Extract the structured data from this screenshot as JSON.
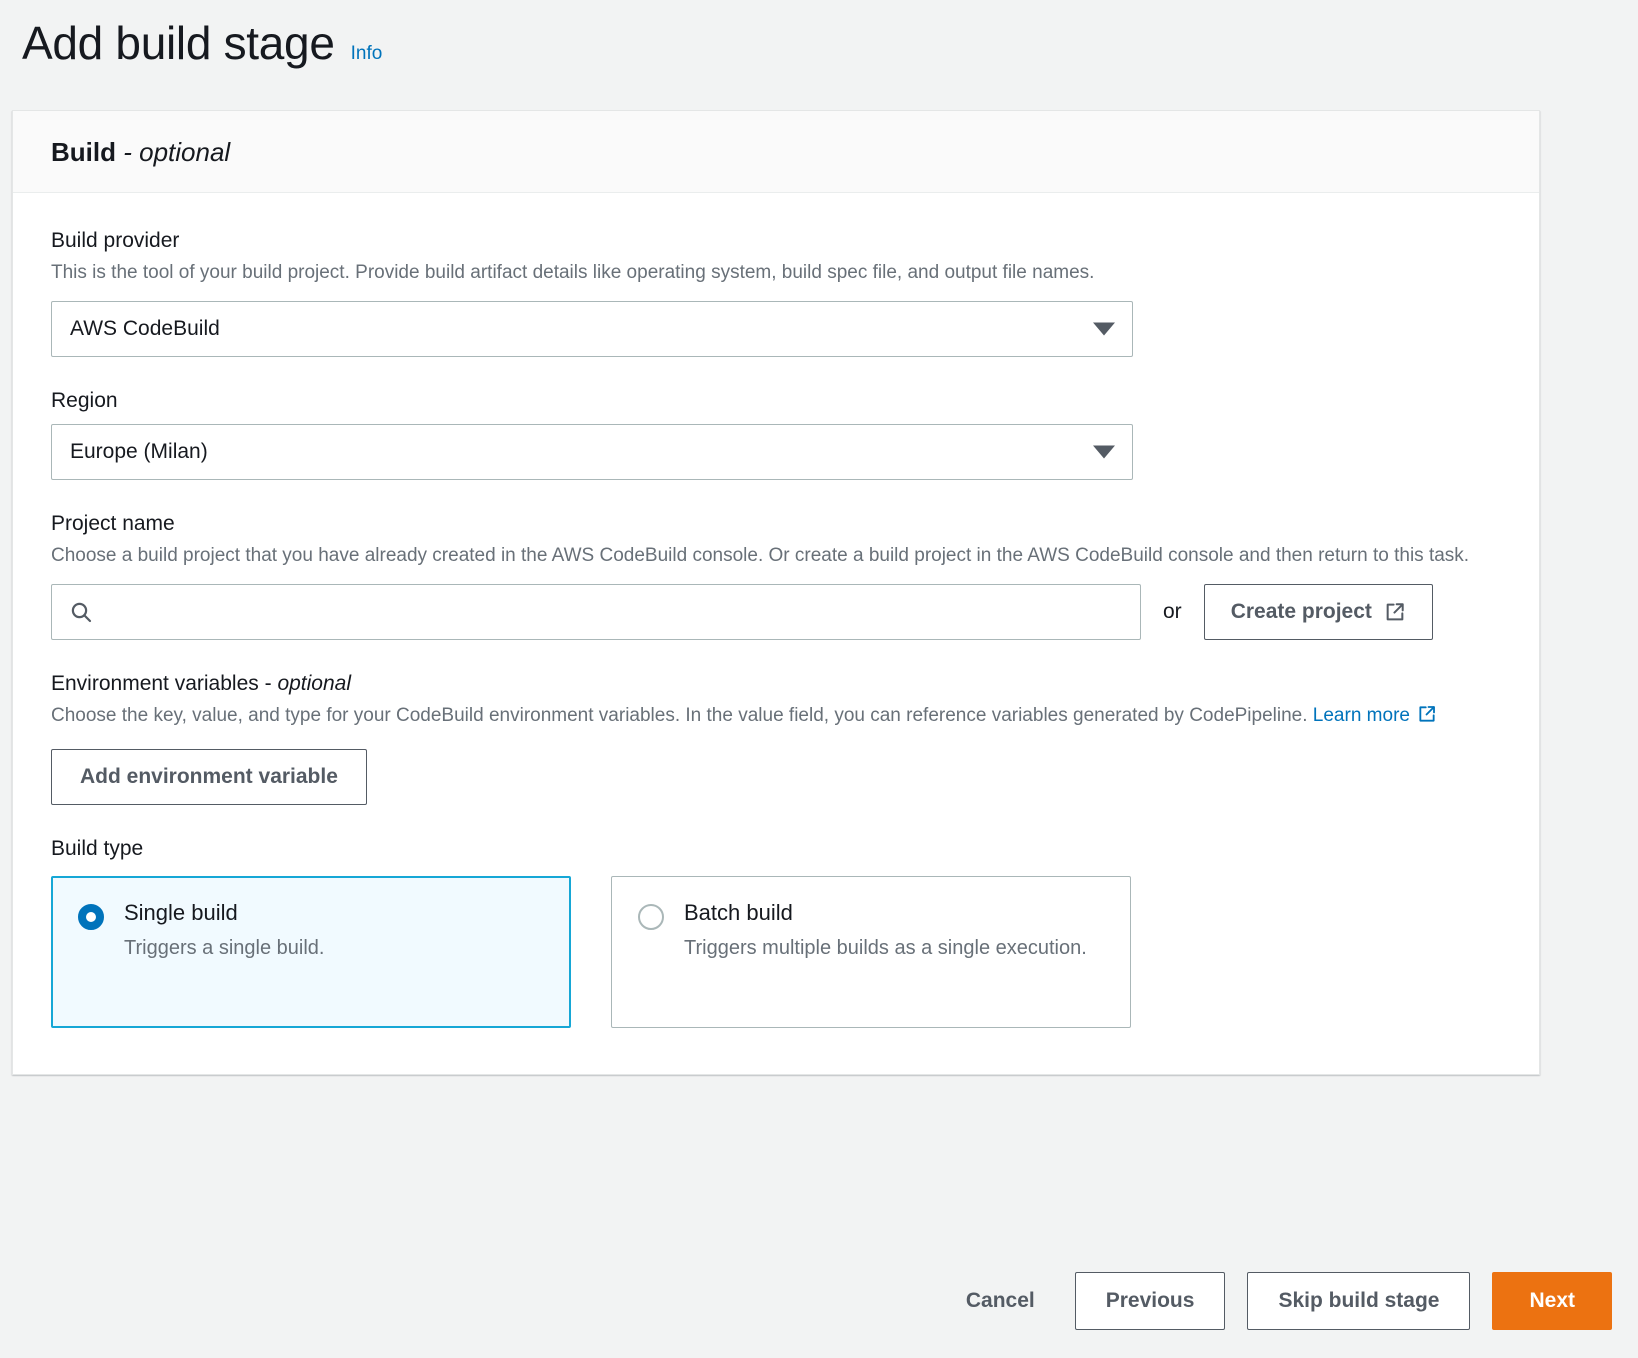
{
  "header": {
    "title": "Add build stage",
    "info_label": "Info"
  },
  "card": {
    "title_main": "Build",
    "title_separator": " - ",
    "title_optional": "optional"
  },
  "fields": {
    "build_provider": {
      "label": "Build provider",
      "description": "This is the tool of your build project. Provide build artifact details like operating system, build spec file, and output file names.",
      "selected_value": "AWS CodeBuild"
    },
    "region": {
      "label": "Region",
      "selected_value": "Europe (Milan)"
    },
    "project_name": {
      "label": "Project name",
      "description": "Choose a build project that you have already created in the AWS CodeBuild console. Or create a build project in the AWS CodeBuild console and then return to this task.",
      "search_value": "",
      "search_placeholder": "",
      "or_label": "or",
      "create_project_label": "Create project"
    },
    "environment_variables": {
      "label_main": "Environment variables",
      "label_separator": " - ",
      "label_optional": "optional",
      "description_part1": "Choose the key, value, and type for your CodeBuild environment variables. In the value field, you can reference variables generated by CodePipeline. ",
      "learn_more_label": "Learn more",
      "add_button_label": "Add environment variable"
    },
    "build_type": {
      "label": "Build type",
      "options": [
        {
          "title": "Single build",
          "description": "Triggers a single build.",
          "selected": true
        },
        {
          "title": "Batch build",
          "description": "Triggers multiple builds as a single execution.",
          "selected": false
        }
      ]
    }
  },
  "footer": {
    "cancel_label": "Cancel",
    "previous_label": "Previous",
    "skip_label": "Skip build stage",
    "next_label": "Next"
  },
  "colors": {
    "accent_blue": "#0073bb",
    "selected_tile_border": "#16a7d6",
    "selected_tile_bg": "#f1faff",
    "primary_button": "#ec7211",
    "page_bg": "#f2f3f3",
    "text_primary": "#16191f",
    "text_secondary": "#687078"
  }
}
